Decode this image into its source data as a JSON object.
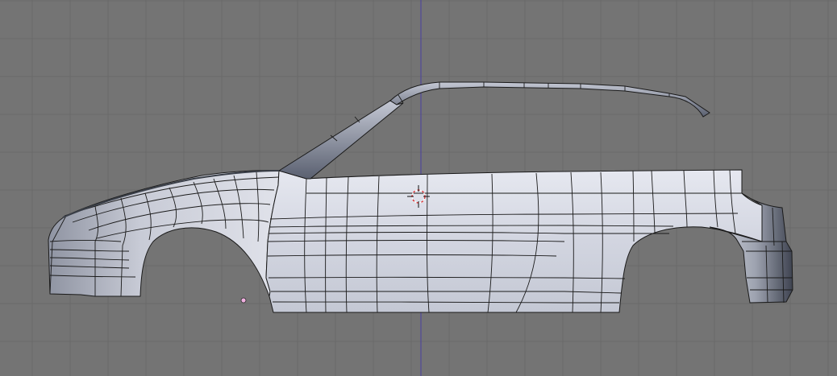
{
  "viewport": {
    "view": "side",
    "background_color": "#747474",
    "grid_color": "#6a6a6a",
    "axis_color": "#4a3fa0",
    "mesh_fill_color": "#c8ccd8",
    "mesh_shadow_color": "#5b6270",
    "wire_color": "#1a1a1a"
  },
  "objects": [
    {
      "name": "car-body-mesh",
      "type": "mesh",
      "mode": "wireframe-over-solid"
    }
  ],
  "cursor": {
    "name": "3d-cursor-icon",
    "color": "#e02020"
  },
  "origin": {
    "name": "object-origin-icon",
    "color": "#f0b0e0"
  }
}
